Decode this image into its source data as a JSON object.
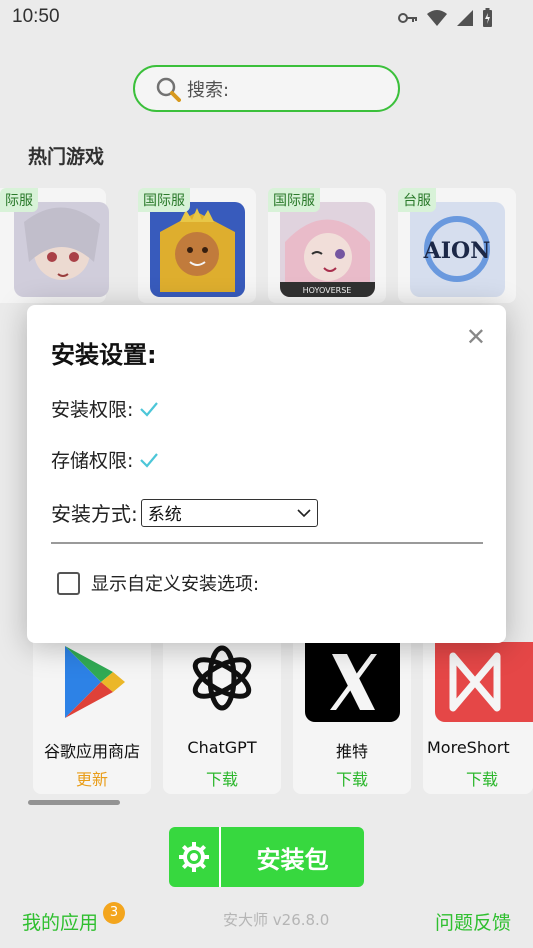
{
  "status_bar": {
    "time": "10:50"
  },
  "search": {
    "placeholder": "搜索:"
  },
  "section": {
    "hot_games": "热门游戏"
  },
  "games": [
    {
      "badge": "际服"
    },
    {
      "badge": "国际服"
    },
    {
      "badge": "国际服",
      "logo_text": "HOYOVERSE"
    },
    {
      "badge": "台服",
      "logo_text": "AION"
    }
  ],
  "dialog": {
    "title": "安装设置:",
    "install_permission": "安装权限:",
    "storage_permission": "存储权限:",
    "install_method_label": "安装方式:",
    "install_method_value": "系统",
    "custom_options_label": "显示自定义安装选项:",
    "custom_options_checked": false
  },
  "apps": [
    {
      "name": "谷歌应用商店",
      "action": "更新",
      "action_color": "#f3a51d"
    },
    {
      "name": "ChatGPT",
      "action": "下载",
      "action_color": "#2fbf2f"
    },
    {
      "name": "推特",
      "action": "下载",
      "action_color": "#2fbf2f"
    },
    {
      "name": "MoreShort",
      "action": "下载",
      "action_color": "#2fbf2f"
    }
  ],
  "install_button": {
    "label": "安装包"
  },
  "footer": {
    "my_apps": "我的应用",
    "my_apps_count": "3",
    "version": "安大师 v26.8.0",
    "feedback": "问题反馈"
  },
  "colors": {
    "accent": "#37d83f",
    "accent_text": "#2fbf2f",
    "update": "#f3a51d"
  }
}
